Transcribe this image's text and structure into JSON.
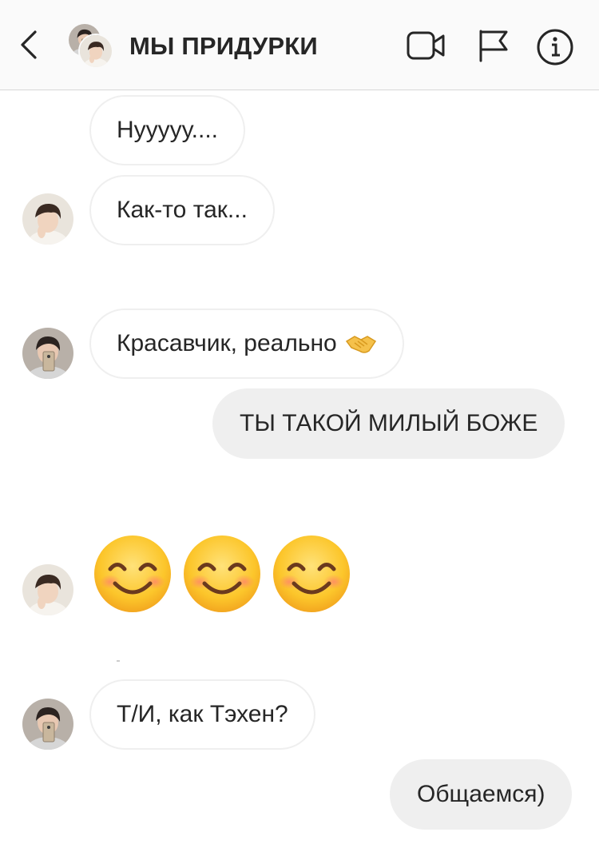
{
  "header": {
    "title": "МЫ ПРИДУРКИ"
  },
  "messages": {
    "m1": "Нууууу....",
    "m2": "Как-то так...",
    "m3": "Красавчик, реально",
    "m4": "ТЫ ТАКОЙ МИЛЫЙ БОЖЕ",
    "m5": "Т/И, как Тэхен?",
    "m6": "Общаемся)"
  },
  "icons": {
    "back": "chevron-left-icon",
    "video": "video-camera-icon",
    "flag": "flag-icon",
    "info": "info-icon",
    "handshake": "handshake-emoji",
    "smile": "smiling-face-emoji"
  },
  "colors": {
    "header_bg": "#fafafa",
    "outgoing_bubble": "#efefef",
    "incoming_border": "#efefef",
    "text": "#262626"
  }
}
